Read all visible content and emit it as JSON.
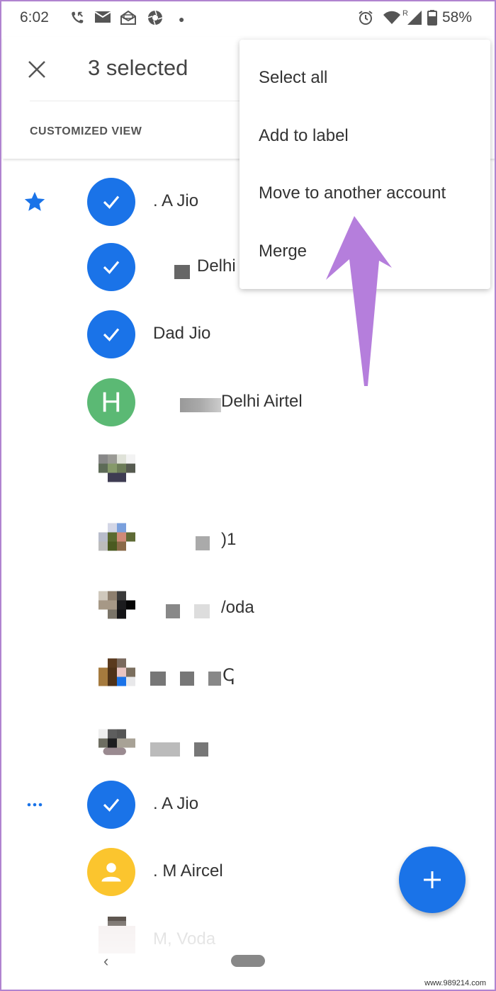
{
  "status_bar": {
    "time": "6:02",
    "left_icons": [
      "missed-call-icon",
      "email-icon",
      "opened-mail-icon",
      "aperture-icon",
      "dot-icon"
    ],
    "right_icons": [
      "alarm-icon",
      "wifi-icon",
      "signal-icon",
      "battery-icon"
    ],
    "roaming_indicator": "R",
    "battery_percent": "58%"
  },
  "app_bar": {
    "close_icon": "close-icon",
    "title": "3 selected",
    "view_label": "CUSTOMIZED VIEW"
  },
  "overflow_menu": {
    "items": [
      {
        "label": "Select all"
      },
      {
        "label": "Add to label"
      },
      {
        "label": "Move to another account"
      },
      {
        "label": "Merge"
      }
    ]
  },
  "contacts": [
    {
      "name": ". A Jio",
      "avatar": "check",
      "selected": true,
      "left_marker": "star-icon"
    },
    {
      "name": "Delhi",
      "avatar": "check",
      "selected": true,
      "redacted_prefix": true
    },
    {
      "name": "Dad Jio",
      "avatar": "check",
      "selected": true
    },
    {
      "name": "Delhi Airtel",
      "avatar": "letter",
      "avatar_letter": "H",
      "selected": false,
      "redacted_prefix": true
    },
    {
      "name": "",
      "avatar": "photo",
      "selected": false,
      "redacted_prefix": true
    },
    {
      "name": ")1",
      "avatar": "photo",
      "selected": false,
      "redacted_prefix": true
    },
    {
      "name": "/oda",
      "avatar": "photo",
      "selected": false,
      "redacted_prefix": true
    },
    {
      "name": "ↅ",
      "avatar": "photo",
      "selected": false,
      "redacted_prefix": true
    },
    {
      "name": "",
      "avatar": "photo",
      "selected": false,
      "redacted_prefix": true
    },
    {
      "name": ". A Jio",
      "avatar": "check",
      "selected": true,
      "left_marker": "more-dots-icon"
    },
    {
      "name": ". M Aircel",
      "avatar": "person",
      "selected": false
    },
    {
      "name": "M, Voda",
      "avatar": "photo",
      "selected": false,
      "faded": true
    }
  ],
  "fab": {
    "icon": "plus-icon",
    "label": "Create contact"
  },
  "nav_bar": {
    "back_icon": "back-chevron-icon",
    "home_icon": "home-pill-icon"
  },
  "annotation": {
    "type": "arrow",
    "color": "#b57edc",
    "points_to": "Move to another account"
  },
  "watermark": "www.989214.com",
  "colors": {
    "accent": "#1a73e8",
    "green_avatar": "#5bb974",
    "yellow_avatar": "#fbc52e",
    "annotation_purple": "#b57edc",
    "frame_border": "#b084d0"
  }
}
